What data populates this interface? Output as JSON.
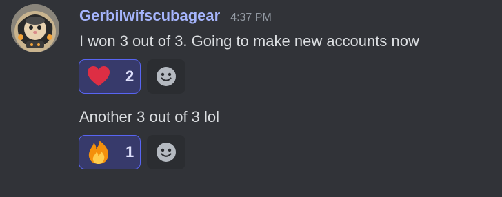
{
  "message_group": {
    "username": "Gerbilwifscubagear",
    "timestamp": "4:37 PM",
    "avatar_icon": "gerbil-scuba-avatar",
    "colors": {
      "background": "#313338",
      "username": "#a5b4fc",
      "timestamp": "#949ba4",
      "text": "#dbdee1",
      "reaction_bg": "#373a6b",
      "reaction_border": "#5865f2",
      "add_reaction_bg": "#2b2d31"
    },
    "messages": [
      {
        "text": "I won 3 out of 3. Going to make new accounts now",
        "reaction": {
          "emoji": "heart-emoji",
          "count": "2"
        },
        "add_reaction_icon": "smiley-icon"
      },
      {
        "text": "Another 3 out of 3 lol",
        "reaction": {
          "emoji": "fire-emoji",
          "count": "1"
        },
        "add_reaction_icon": "smiley-icon"
      }
    ]
  }
}
